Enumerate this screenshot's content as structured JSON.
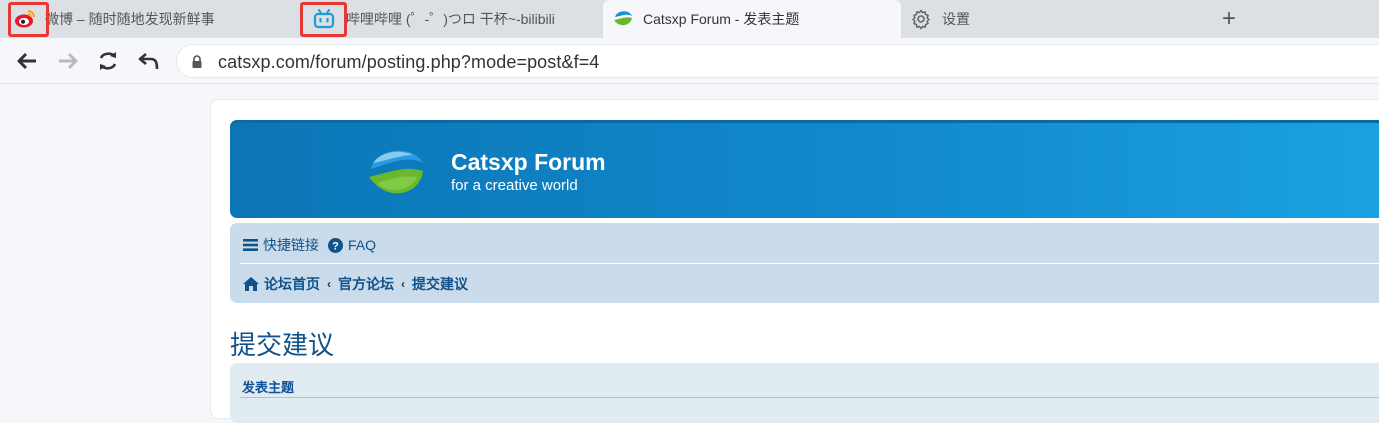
{
  "browser": {
    "tabs": [
      {
        "title": "微博 – 随时随地发现新鲜事",
        "icon": "weibo-icon",
        "active": false
      },
      {
        "title": "哔哩哔哩 (゜-゜)つロ 干杯~-bilibili",
        "icon": "bilibili-icon",
        "active": false
      },
      {
        "title": "Catsxp Forum - 发表主题",
        "icon": "catsxp-icon",
        "active": true
      },
      {
        "title": "设置",
        "icon": "gear-icon",
        "active": false
      }
    ],
    "new_tab_label": "+",
    "url": "catsxp.com/forum/posting.php?mode=post&f=4",
    "highlight_color": "#e53935"
  },
  "forum": {
    "site_title": "Catsxp Forum",
    "site_description": "for a creative world",
    "nav": {
      "quick_links": "快捷链接",
      "faq": "FAQ"
    },
    "breadcrumb": [
      "论坛首页",
      "官方论坛",
      "提交建议"
    ],
    "page_title": "提交建议",
    "panel_title": "发表主题"
  },
  "colors": {
    "header_gradient_start": "#0b76b6",
    "header_gradient_end": "#1ba2e0",
    "link": "#105289",
    "navbar_bg": "#cadceb"
  }
}
